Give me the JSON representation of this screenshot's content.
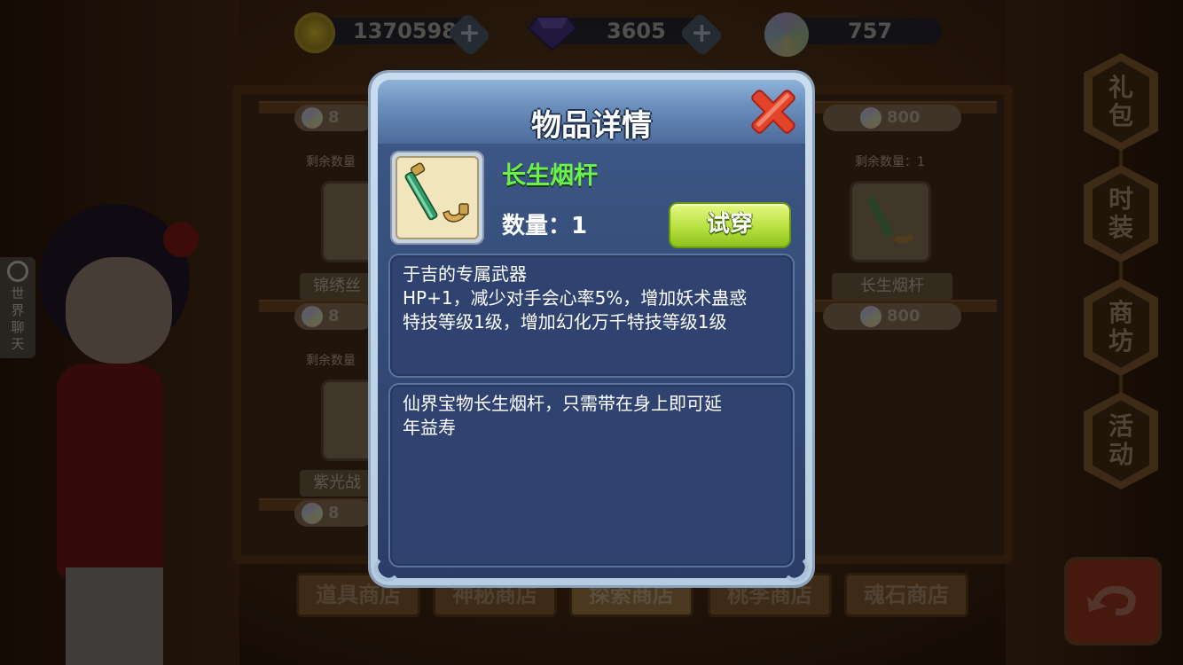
{
  "currencies": {
    "coins": "1370598",
    "diamonds": "3605",
    "soul_stones": "757"
  },
  "background": {
    "left_items": [
      {
        "price": "8",
        "remain": "剩余数量",
        "name": "锦绣丝"
      },
      {
        "price": "8",
        "remain": "剩余数量",
        "name": "紫光战"
      },
      {
        "price": "8"
      }
    ],
    "right_items": [
      {
        "price": "800"
      },
      {
        "remain": "剩余数量：1",
        "name": "长生烟杆",
        "price": "800"
      }
    ],
    "side_menu": [
      "礼包",
      "时装",
      "商坊",
      "活动"
    ],
    "chat_tab": "世界聊天",
    "tabs": [
      "道具商店",
      "神秘商店",
      "探索商店",
      "桃李商店",
      "魂石商店"
    ]
  },
  "dialog": {
    "title": "物品详情",
    "item_name": "长生烟杆",
    "quantity_label": "数量：1",
    "try_button": "试穿",
    "effect_lines": [
      "于吉的专属武器",
      "HP+1，减少对手会心率5%，增加妖术蛊惑",
      "特技等级1级，增加幻化万千特技等级1级"
    ],
    "lore_lines": [
      "仙界宝物长生烟杆，只需带在身上即可延",
      "年益寿"
    ]
  },
  "colors": {
    "item_name_green": "#6cf14c",
    "dialog_blue": "#2f4270",
    "try_button_green": "#b8e040",
    "close_red": "#e2442a"
  }
}
